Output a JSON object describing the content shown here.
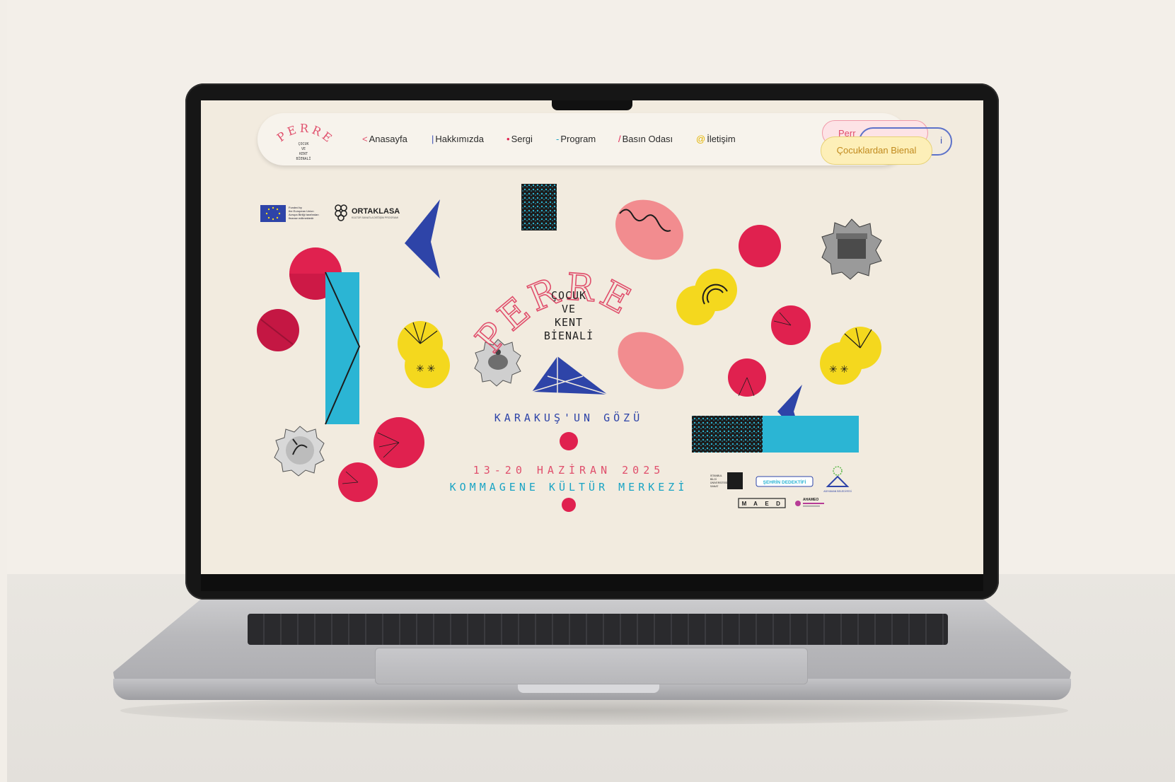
{
  "nav": {
    "items": [
      {
        "mark": "<",
        "label": "Anasayfa",
        "color": "#e04f6c"
      },
      {
        "mark": "|",
        "label": "Hakkımızda",
        "color": "#3b4fb3"
      },
      {
        "mark": "•",
        "label": "Sergi",
        "color": "#e0214f"
      },
      {
        "mark": "-",
        "label": "Program",
        "color": "#1aa4c4"
      },
      {
        "mark": "/",
        "label": "Basın Odası",
        "color": "#e0214f"
      },
      {
        "mark": "@",
        "label": "İletişim",
        "color": "#e3b400"
      }
    ],
    "pill_pink": "Perr",
    "pill_blue": "i",
    "pill_yellow": "Çocuklardan Bienal"
  },
  "logo": {
    "word": "PERRE",
    "lines": [
      "ÇOCUK",
      "VE",
      "KENT",
      "BİENALİ"
    ]
  },
  "sponsors_top": {
    "eu_lines": [
      "Funded by",
      "the European Union",
      "Avrupa Birliği tarafından",
      "finanse edilmektedir"
    ],
    "ortaklasa": "ORTAKLASA",
    "ortaklasa_sub": "KÜLTÜR SANATLA DEĞİŞİM PROGRAMI"
  },
  "hero": {
    "title": "PERRE",
    "subtitle_lines": [
      "ÇOCUK",
      "VE",
      "KENT",
      "BİENALİ"
    ],
    "tagline": "KARAKUŞ'UN GÖZÜ",
    "dates": "13-20 HAZİRAN 2025",
    "venue": "KOMMAGENE KÜLTÜR MERKEZİ"
  },
  "sponsors_bottom": {
    "istanbul": [
      "İSTANBUL",
      "BİLGİ",
      "ÜNİVERSİTESİ",
      "SANAT"
    ],
    "sehir": "ŞEHRİN DEDEKTİFİ",
    "adiyaman": "ADIYAMAN BELEDİYESİ",
    "maed": [
      "M",
      "A",
      "E",
      "D"
    ],
    "ahameo": "AHAMEO"
  },
  "colors": {
    "background": "#f2ebdf",
    "red": "#e0214f",
    "pink": "#f28c8f",
    "blue": "#2e44a8",
    "cyan": "#2bb5d4",
    "yellow": "#f4d81e",
    "title_red": "#e04f6c"
  }
}
